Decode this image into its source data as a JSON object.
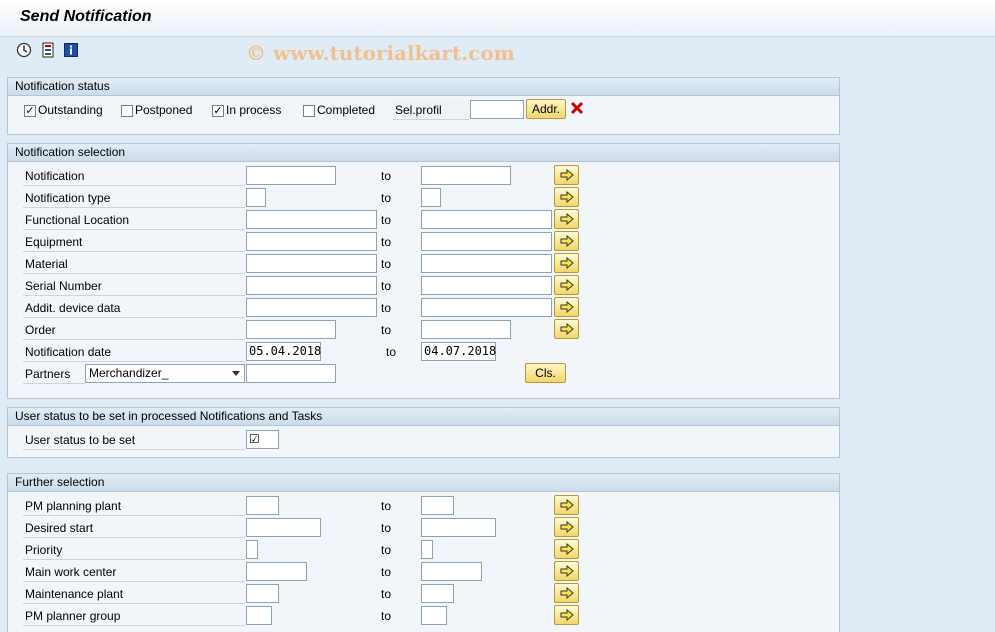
{
  "window": {
    "title": "Send Notification"
  },
  "watermark": "© www.tutorialkart.com",
  "toolbar": {
    "icons": [
      "execute-icon",
      "selection-variant-icon",
      "info-icon"
    ]
  },
  "status_group": {
    "title": "Notification status",
    "outstanding": {
      "label": "Outstanding",
      "checked": true
    },
    "postponed": {
      "label": "Postponed",
      "checked": false
    },
    "in_process": {
      "label": "In process",
      "checked": true
    },
    "completed": {
      "label": "Completed",
      "checked": false
    },
    "sel_profil": {
      "label": "Sel.profil",
      "value": ""
    },
    "addr_button": "Addr."
  },
  "selection_group": {
    "title": "Notification selection",
    "to_label": "to",
    "rows": [
      {
        "label": "Notification",
        "from": "",
        "to": ""
      },
      {
        "label": "Notification type",
        "from": "",
        "to": ""
      },
      {
        "label": "Functional Location",
        "from": "",
        "to": ""
      },
      {
        "label": "Equipment",
        "from": "",
        "to": ""
      },
      {
        "label": "Material",
        "from": "",
        "to": ""
      },
      {
        "label": "Serial Number",
        "from": "",
        "to": ""
      },
      {
        "label": "Addit. device data",
        "from": "",
        "to": ""
      },
      {
        "label": "Order",
        "from": "",
        "to": ""
      },
      {
        "label": "Notification date",
        "from": "05.04.2018",
        "to": "04.07.2018"
      }
    ],
    "partners": {
      "label": "Partners",
      "role": "Merchandizer_",
      "value": ""
    },
    "cls_button": "Cls."
  },
  "user_status_group": {
    "title": "User status to be set in processed Notifications and Tasks",
    "label": "User status to be set",
    "value": "☑"
  },
  "further_group": {
    "title": "Further selection",
    "to_label": "to",
    "rows": [
      {
        "label": "PM planning plant",
        "from": "",
        "to": ""
      },
      {
        "label": "Desired start",
        "from": "",
        "to": ""
      },
      {
        "label": "Priority",
        "from": "",
        "to": ""
      },
      {
        "label": "Main work center",
        "from": "",
        "to": ""
      },
      {
        "label": "Maintenance plant",
        "from": "",
        "to": ""
      },
      {
        "label": "PM planner group",
        "from": "",
        "to": ""
      }
    ]
  },
  "colors": {
    "accent": "#f1d765",
    "background": "#dfebf5",
    "delete": "#cc0000"
  }
}
